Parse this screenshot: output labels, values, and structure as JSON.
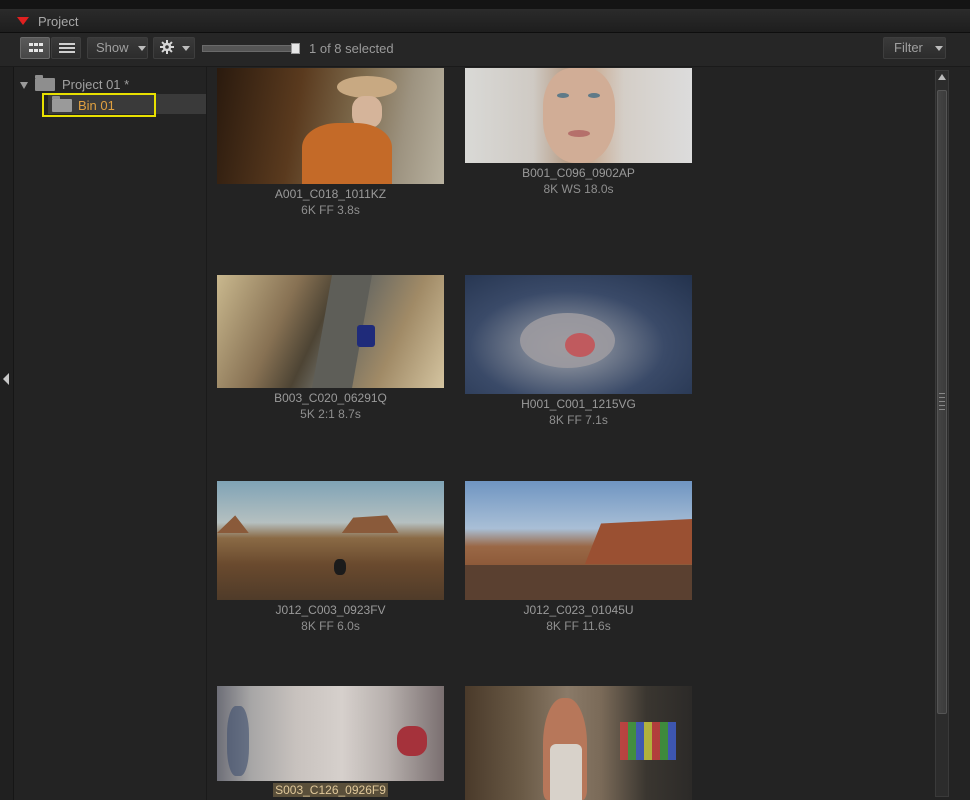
{
  "panel": {
    "title": "Project"
  },
  "toolbar": {
    "show_label": "Show",
    "filter_label": "Filter",
    "selection_count": "1 of 8 selected",
    "zoom_level": 1.0
  },
  "tree": {
    "project": "Project 01 *",
    "bin": "Bin 01"
  },
  "clips": [
    {
      "name": "A001_C018_1011KZ",
      "meta": "6K FF   3.8s"
    },
    {
      "name": "B001_C096_0902AP",
      "meta": "8K WS   18.0s"
    },
    {
      "name": "B003_C020_06291Q",
      "meta": "5K 2:1   8.7s"
    },
    {
      "name": "H001_C001_1215VG",
      "meta": "8K FF   7.1s"
    },
    {
      "name": "J012_C003_0923FV",
      "meta": "8K FF   6.0s"
    },
    {
      "name": "J012_C023_01045U",
      "meta": "8K FF   11.6s"
    },
    {
      "name": "S003_C126_0926F9",
      "meta": ""
    },
    {
      "name": "",
      "meta": ""
    }
  ],
  "colors": {
    "accent_red": "#e02020",
    "selection_outline": "#e8e000",
    "selected_text": "#e0a040"
  }
}
